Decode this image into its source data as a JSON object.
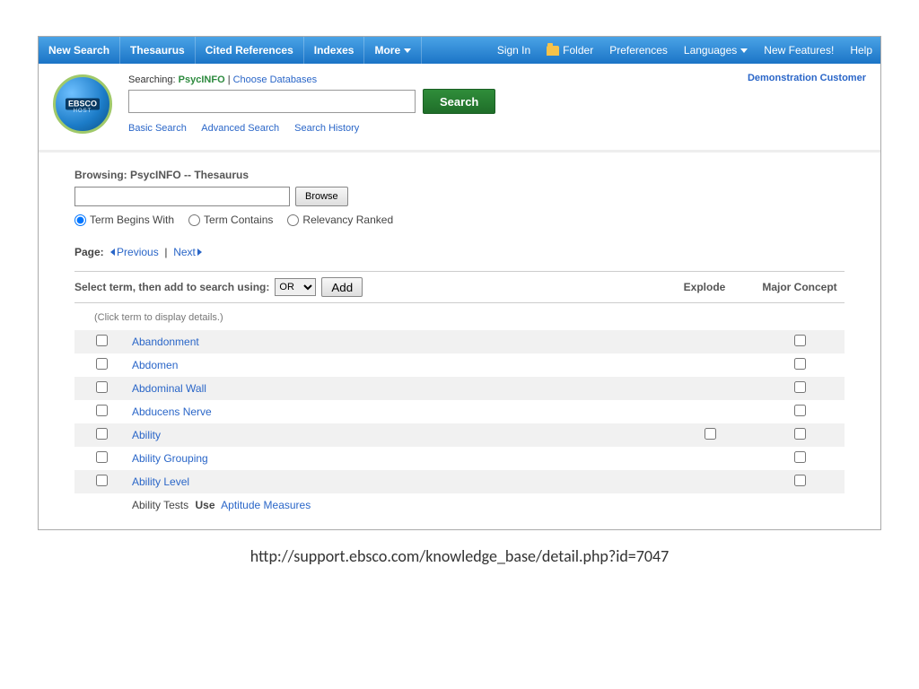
{
  "topnav": {
    "left": [
      "New Search",
      "Thesaurus",
      "Cited References",
      "Indexes"
    ],
    "more": "More",
    "right": {
      "signin": "Sign In",
      "folder": "Folder",
      "preferences": "Preferences",
      "languages": "Languages",
      "newfeatures": "New Features!",
      "help": "Help"
    }
  },
  "header": {
    "logo_text": "EBSCO",
    "logo_sub": "HOST",
    "searching_prefix": "Searching:",
    "database": "PsycINFO",
    "choose": "Choose Databases",
    "search_btn": "Search",
    "sublinks": [
      "Basic Search",
      "Advanced Search",
      "Search History"
    ],
    "demo": "Demonstration Customer"
  },
  "browse": {
    "label": "Browsing: PsycINFO -- Thesaurus",
    "button": "Browse",
    "radios": [
      "Term Begins With",
      "Term Contains",
      "Relevancy Ranked"
    ],
    "radio_selected": 0
  },
  "paging": {
    "label": "Page:",
    "prev": "Previous",
    "next": "Next"
  },
  "selectbar": {
    "label": "Select term, then add to search using:",
    "operator_options": [
      "OR",
      "AND",
      "NOT"
    ],
    "operator_selected": "OR",
    "add": "Add",
    "col_explode": "Explode",
    "col_major": "Major Concept"
  },
  "hint": "(Click term to display details.)",
  "terms": [
    {
      "label": "Abandonment",
      "explode": false,
      "major": true
    },
    {
      "label": "Abdomen",
      "explode": false,
      "major": true
    },
    {
      "label": "Abdominal Wall",
      "explode": false,
      "major": true
    },
    {
      "label": "Abducens Nerve",
      "explode": false,
      "major": true
    },
    {
      "label": "Ability",
      "explode": true,
      "major": true
    },
    {
      "label": "Ability Grouping",
      "explode": false,
      "major": true
    },
    {
      "label": "Ability Level",
      "explode": false,
      "major": true
    }
  ],
  "use_row": {
    "term": "Ability Tests",
    "use_label": "Use",
    "target": "Aptitude Measures"
  },
  "caption": "http://support.ebsco.com/knowledge_base/detail.php?id=7047"
}
